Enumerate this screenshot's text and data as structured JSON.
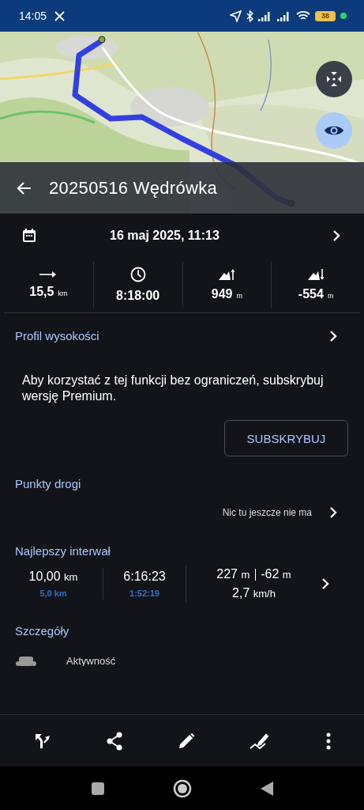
{
  "status_bar": {
    "time": "14:05",
    "battery": "38"
  },
  "map_buttons": [
    {
      "kind": "fit"
    },
    {
      "kind": "eye"
    }
  ],
  "title": "20250516 Wędrówka",
  "date": "16 maj 2025, 11:13",
  "stats": [
    {
      "kind": "distance",
      "value": "15,5",
      "unit": "km"
    },
    {
      "kind": "time",
      "value": "8:18:00"
    },
    {
      "kind": "ascent",
      "value": "949",
      "unit": "m"
    },
    {
      "kind": "descent",
      "value": "-554",
      "unit": "m"
    }
  ],
  "profile": {
    "title": "Profil wysokości",
    "message": "Aby korzystać z tej funkcji bez ograniczeń, subskrybuj wersję Premium.",
    "button": "SUBSKRYBUJ"
  },
  "waypoints": {
    "title": "Punkty drogi",
    "empty_text": "Nic tu jeszcze nie ma"
  },
  "best_interval": {
    "title": "Najlepszy interwał",
    "distance": "10,00",
    "distance_unit": "km",
    "step": "5,0",
    "step_unit": "km",
    "duration": "6:16:23",
    "split": "1:52:19",
    "ascent": "227",
    "ascent_unit": "m",
    "descent": "-62",
    "descent_unit": "m",
    "speed": "2,7",
    "speed_unit": "km/h"
  },
  "details": {
    "title": "Szczegóły",
    "items": [
      {
        "label": "Aktywność"
      }
    ]
  },
  "toolbar": [
    {
      "kind": "route"
    },
    {
      "kind": "share"
    },
    {
      "kind": "edit"
    },
    {
      "kind": "profile"
    },
    {
      "kind": "more"
    }
  ],
  "nav_bar": [
    {
      "kind": "recents"
    },
    {
      "kind": "home"
    },
    {
      "kind": "back"
    }
  ]
}
